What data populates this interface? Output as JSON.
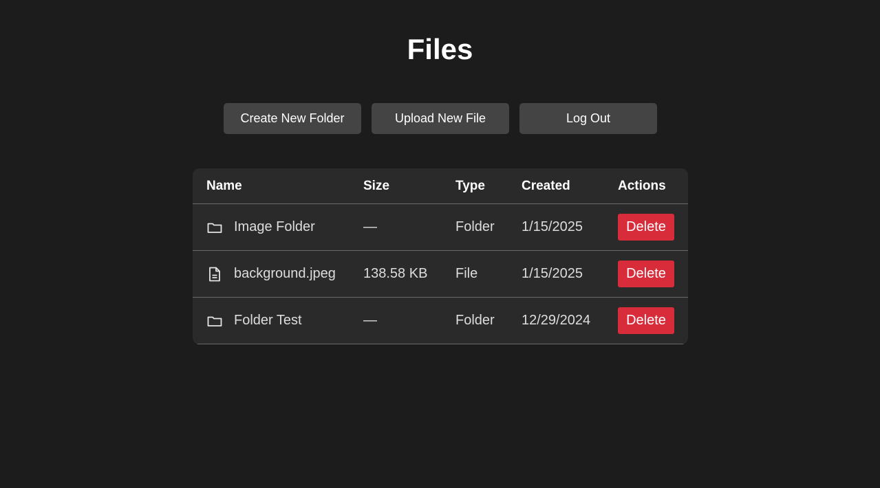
{
  "page": {
    "title": "Files"
  },
  "toolbar": {
    "create_folder_label": "Create New Folder",
    "upload_file_label": "Upload New File",
    "logout_label": "Log Out"
  },
  "table": {
    "headers": {
      "name": "Name",
      "size": "Size",
      "type": "Type",
      "created": "Created",
      "actions": "Actions"
    },
    "rows": [
      {
        "icon": "folder-icon",
        "name": "Image Folder",
        "size": "—",
        "type": "Folder",
        "created": "1/15/2025",
        "action": "Delete"
      },
      {
        "icon": "file-icon",
        "name": "background.jpeg",
        "size": "138.58 KB",
        "type": "File",
        "created": "1/15/2025",
        "action": "Delete"
      },
      {
        "icon": "folder-icon",
        "name": "Folder Test",
        "size": "—",
        "type": "Folder",
        "created": "12/29/2024",
        "action": "Delete"
      }
    ]
  },
  "colors": {
    "background": "#1c1c1c",
    "button": "#444444",
    "table": "#2a2a2a",
    "delete": "#d82c3a"
  }
}
